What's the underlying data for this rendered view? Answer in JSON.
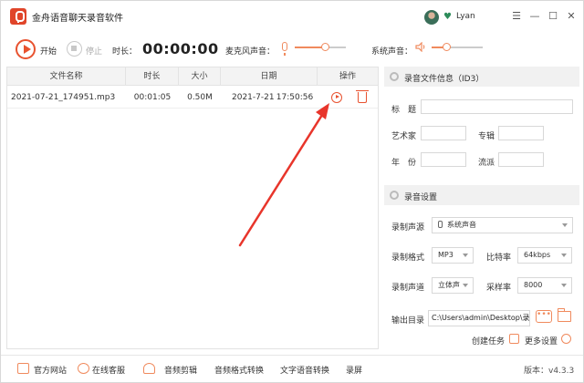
{
  "window": {
    "title": "金舟语音聊天录音软件",
    "user_name": "Lyan"
  },
  "toolbar": {
    "start_label": "开始",
    "stop_label": "停止",
    "duration_label": "时长：",
    "duration_value": "00:00:00",
    "mic_label": "麦克风声音：",
    "mic_volume_percent": 60,
    "system_label": "系统声音：",
    "system_volume_percent": 30
  },
  "file_table": {
    "columns": [
      "文件名称",
      "时长",
      "大小",
      "日期",
      "操作"
    ],
    "rows": [
      {
        "name": "2021-07-21_174951.mp3",
        "duration": "00:01:05",
        "size": "0.50M",
        "date": "2021-7-21",
        "time": "17:50:56"
      }
    ]
  },
  "id3": {
    "header": "录音文件信息（ID3）",
    "title_label": "标　题",
    "artist_label": "艺术家",
    "album_label": "专辑",
    "year_label": "年　份",
    "genre_label": "流派"
  },
  "settings": {
    "header": "录音设置",
    "source_label": "录制声源",
    "source_value": "系统声音",
    "format_label": "录制格式",
    "format_value": "MP3",
    "bitrate_label": "比特率",
    "bitrate_value": "64kbps",
    "channel_label": "录制声道",
    "channel_value": "立体声",
    "samplerate_label": "采样率",
    "samplerate_value": "8000",
    "output_label": "输出目录",
    "output_path": "C:\\Users\\admin\\Desktop\\录音",
    "dots_label": "•••",
    "create_task_label": "创建任务",
    "more_settings_label": "更多设置"
  },
  "footer": {
    "items": [
      "官方网站",
      "在线客服",
      "音频剪辑",
      "音频格式转换",
      "文字语音转换",
      "录屏"
    ],
    "version": "版本：v4.3.3"
  },
  "colors": {
    "accent": "#e8522f",
    "accent_light": "#f08a5d",
    "arrow": "#e8352b"
  }
}
